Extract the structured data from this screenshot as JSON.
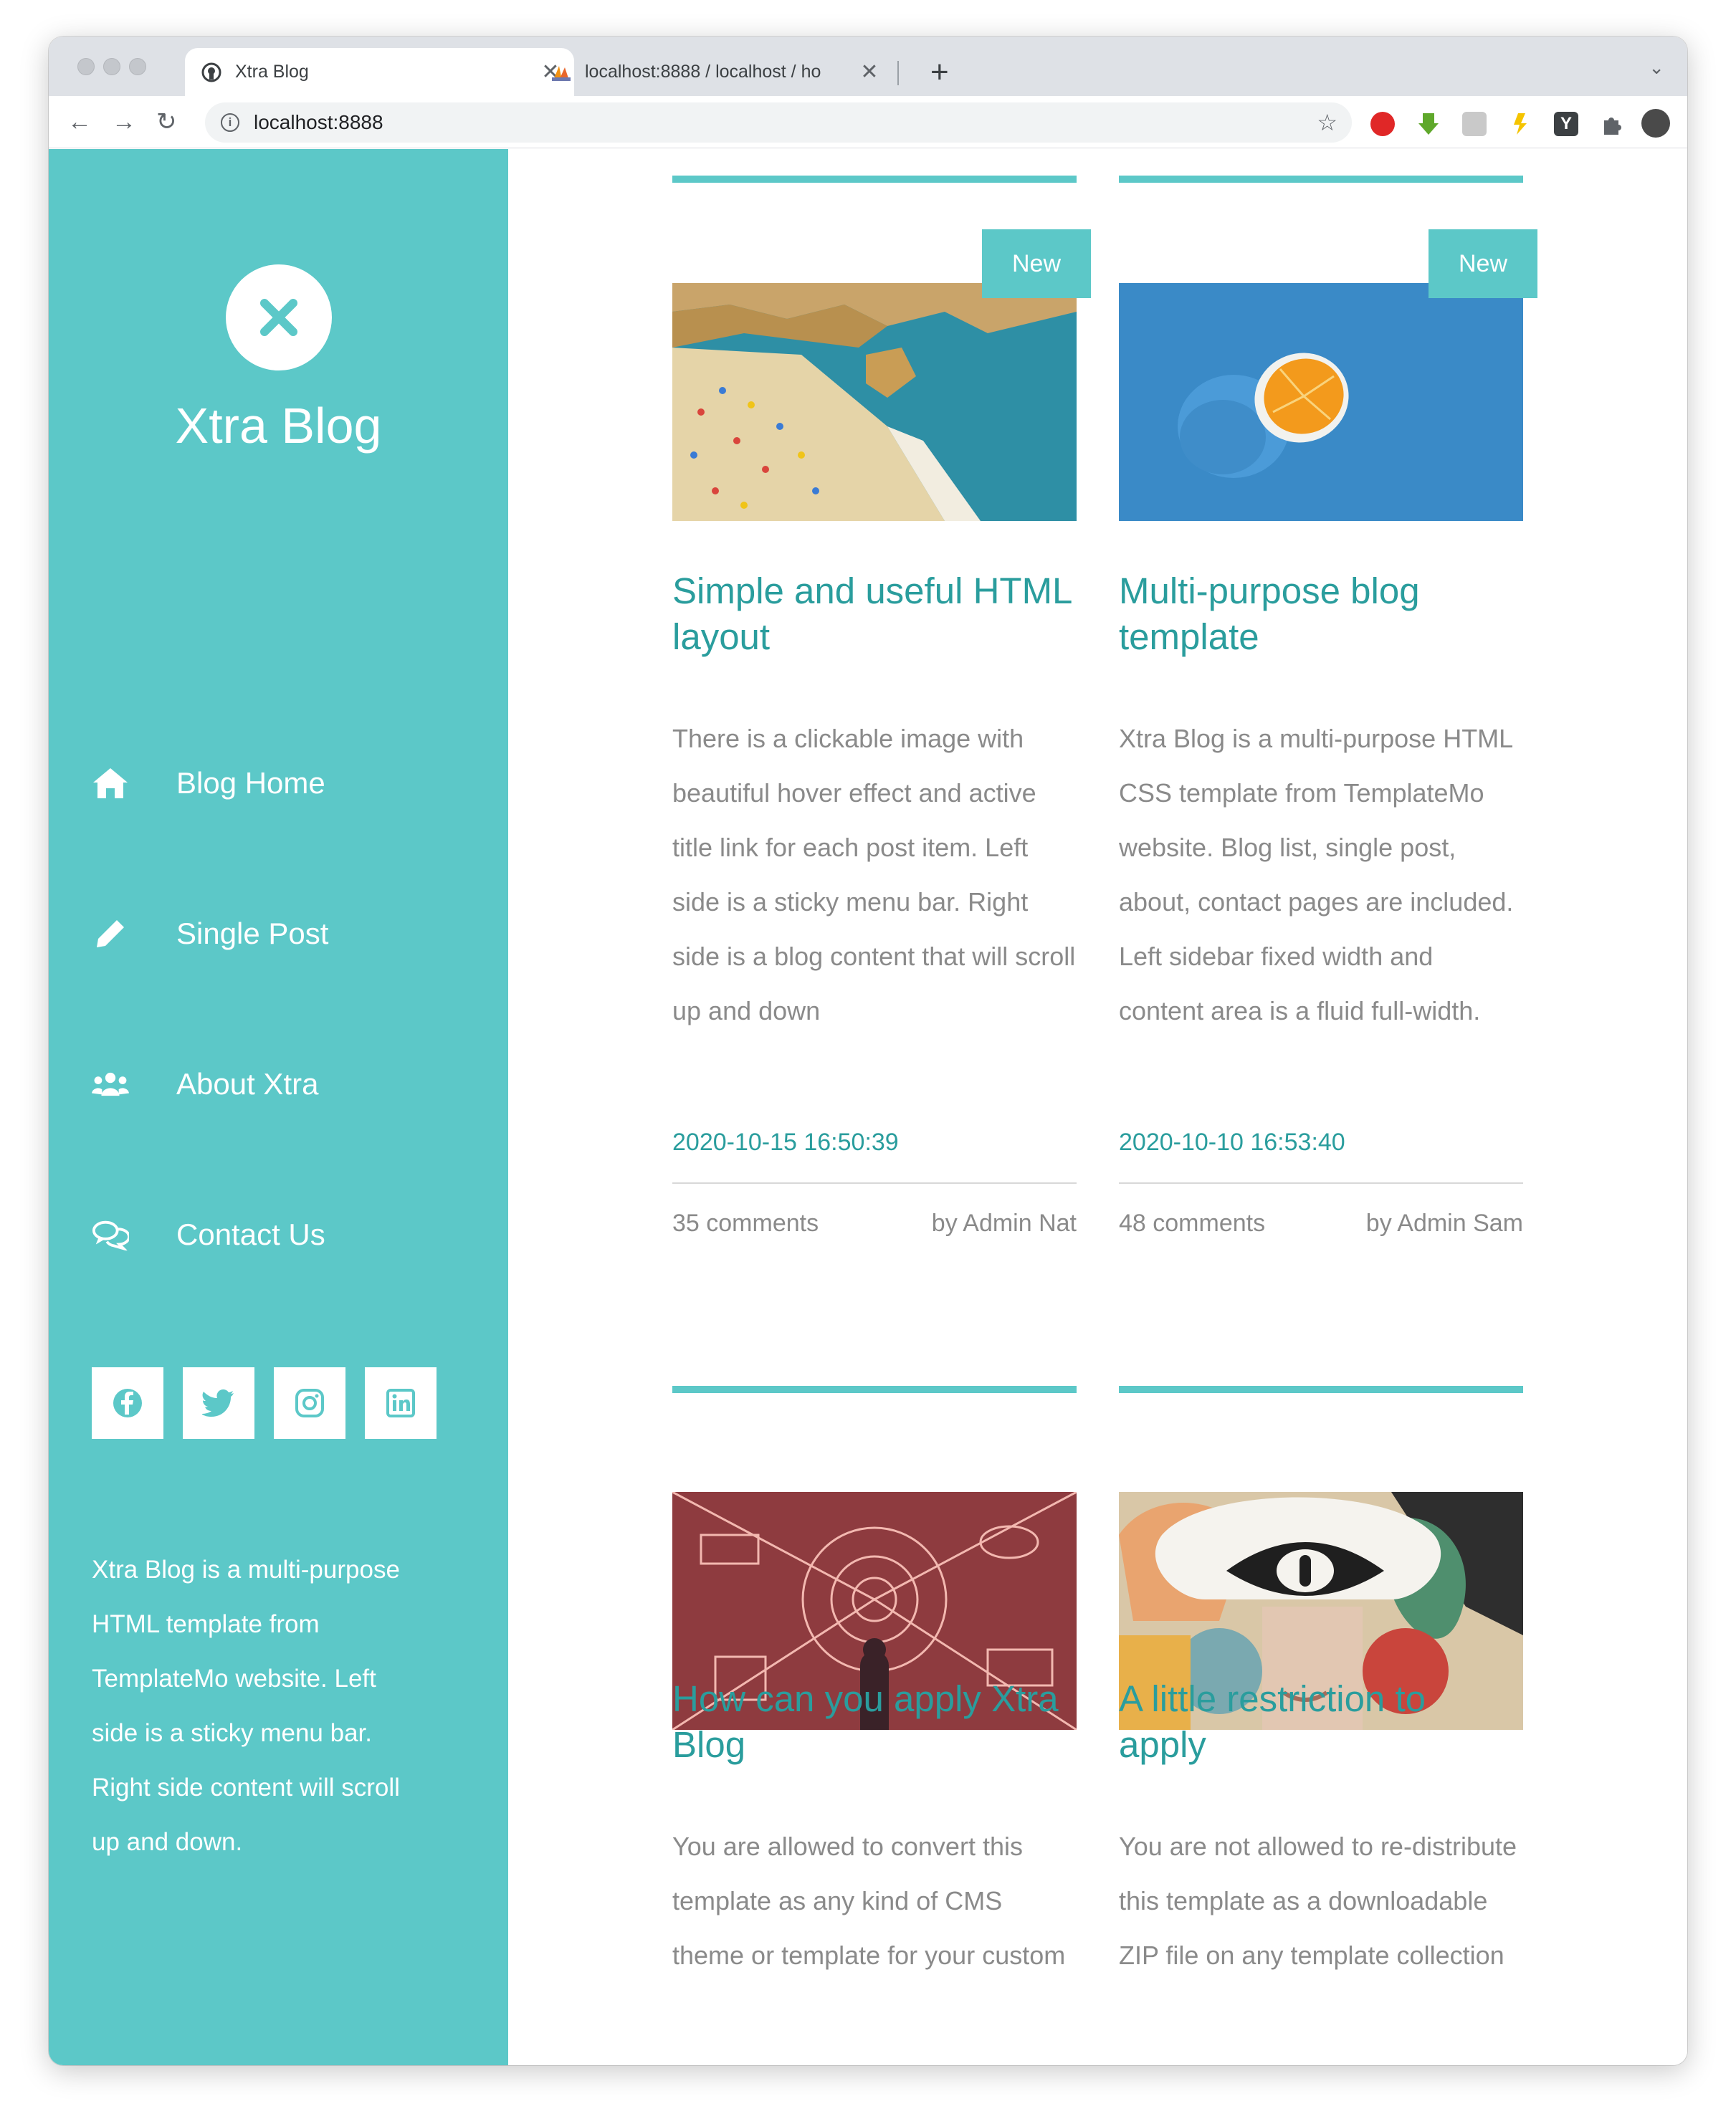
{
  "browser": {
    "tabs": [
      {
        "title": "Xtra Blog",
        "favicon": "github-icon"
      },
      {
        "title": "localhost:8888 / localhost / ho",
        "favicon": "phpmyadmin-icon"
      }
    ],
    "close_glyph": "✕",
    "new_tab_glyph": "+",
    "tab_list_glyph": "⌄",
    "nav": {
      "back": "←",
      "forward": "→",
      "reload": "↻"
    },
    "url": "localhost:8888",
    "info_glyph": "i",
    "bookmark_glyph": "☆",
    "menu_glyph": "⋮"
  },
  "sidebar": {
    "site_title": "Xtra Blog",
    "nav": [
      {
        "label": "Blog Home",
        "icon": "home-icon"
      },
      {
        "label": "Single Post",
        "icon": "pencil-icon"
      },
      {
        "label": "About Xtra",
        "icon": "users-icon"
      },
      {
        "label": "Contact Us",
        "icon": "comments-icon"
      }
    ],
    "social": [
      "facebook-icon",
      "twitter-icon",
      "instagram-icon",
      "linkedin-icon"
    ],
    "description": "Xtra Blog is a multi-purpose HTML template from TemplateMo website. Left side is a sticky menu bar. Right side content will scroll up and down."
  },
  "posts": [
    {
      "badge": "New",
      "image": "beach-photo",
      "title": "Simple and useful HTML layout",
      "excerpt": "There is a clickable image with beautiful hover effect and active title link for each post item. Left side is a sticky menu bar. Right side is a blog content that will scroll up and down",
      "date": "2020-10-15 16:50:39",
      "comments": "35 comments",
      "author": "by Admin Nat"
    },
    {
      "badge": "New",
      "image": "blue-orange-photo",
      "title": "Multi-purpose blog template",
      "excerpt": "Xtra Blog is a multi-purpose HTML CSS template from TemplateMo website. Blog list, single post, about, contact pages are included. Left sidebar fixed width and content area is a fluid full-width.",
      "date": "2020-10-10 16:53:40",
      "comments": "48 comments",
      "author": "by Admin Sam"
    },
    {
      "badge": "",
      "image": "music-instruments-art-photo",
      "title": "How can you apply Xtra Blog",
      "excerpt": "You are allowed to convert this template as any kind of CMS theme or template for your custom",
      "date": "",
      "comments": "",
      "author": ""
    },
    {
      "badge": "",
      "image": "eye-mural-art-photo",
      "title": "A little restriction to apply",
      "excerpt": "You are not allowed to re-distribute this template as a downloadable ZIP file on any template collection",
      "date": "",
      "comments": "",
      "author": ""
    }
  ],
  "colors": {
    "accent": "#5cc8c8",
    "title_teal": "#2a9d9d",
    "muted_text": "#8a8a8a"
  }
}
